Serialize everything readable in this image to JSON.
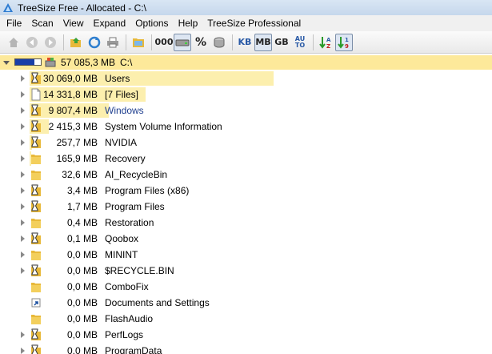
{
  "window": {
    "title": "TreeSize Free - Allocated - C:\\"
  },
  "menu": [
    "File",
    "Scan",
    "View",
    "Expand",
    "Options",
    "Help",
    "TreeSize Professional"
  ],
  "toolbar": {
    "units": {
      "kb": "KB",
      "mb": "MB",
      "gb": "GB",
      "auto_top": "AU",
      "auto_bottom": "TO"
    },
    "percent": "%",
    "count": "000"
  },
  "colors": {
    "bar": "#fcefae",
    "root_bar": "#fde99a",
    "gauge": "#1a3fa8"
  },
  "root": {
    "size": "57 085,3 MB",
    "name": "C:\\",
    "fill_fraction": 0.75
  },
  "rows": [
    {
      "size": "30 069,0 MB",
      "name": "Users",
      "icon": "hourglass-folder-icon",
      "bar": 0.527
    },
    {
      "size": "14 331,8 MB",
      "name": "[7 Files]",
      "icon": "file-icon",
      "bar": 0.251
    },
    {
      "size": "9 807,4 MB",
      "name": "Windows",
      "icon": "hourglass-folder-icon",
      "bar": 0.172,
      "link": true
    },
    {
      "size": "2 415,3 MB",
      "name": "System Volume Information",
      "icon": "hourglass-folder-icon",
      "bar": 0.042
    },
    {
      "size": "257,7 MB",
      "name": "NVIDIA",
      "icon": "hourglass-folder-icon",
      "bar": 0.0045
    },
    {
      "size": "165,9 MB",
      "name": "Recovery",
      "icon": "folder-icon",
      "bar": 0.0029
    },
    {
      "size": "32,6 MB",
      "name": "AI_RecycleBin",
      "icon": "folder-icon",
      "bar": 0
    },
    {
      "size": "3,4 MB",
      "name": "Program Files (x86)",
      "icon": "hourglass-folder-icon",
      "bar": 0
    },
    {
      "size": "1,7 MB",
      "name": "Program Files",
      "icon": "hourglass-folder-icon",
      "bar": 0
    },
    {
      "size": "0,4 MB",
      "name": "Restoration",
      "icon": "folder-icon",
      "bar": 0
    },
    {
      "size": "0,1 MB",
      "name": "Qoobox",
      "icon": "hourglass-folder-icon",
      "bar": 0
    },
    {
      "size": "0,0 MB",
      "name": "MININT",
      "icon": "folder-icon",
      "bar": 0
    },
    {
      "size": "0,0 MB",
      "name": "$RECYCLE.BIN",
      "icon": "hourglass-folder-icon",
      "bar": 0
    },
    {
      "size": "0,0 MB",
      "name": "ComboFix",
      "icon": "folder-icon",
      "bar": 0,
      "noexpand": true
    },
    {
      "size": "0,0 MB",
      "name": "Documents and Settings",
      "icon": "shortcut-icon",
      "bar": 0,
      "noexpand": true
    },
    {
      "size": "0,0 MB",
      "name": "FlashAudio",
      "icon": "folder-icon",
      "bar": 0,
      "noexpand": true
    },
    {
      "size": "0,0 MB",
      "name": "PerfLogs",
      "icon": "hourglass-folder-icon",
      "bar": 0
    },
    {
      "size": "0,0 MB",
      "name": "ProgramData",
      "icon": "hourglass-folder-icon",
      "bar": 0
    }
  ]
}
